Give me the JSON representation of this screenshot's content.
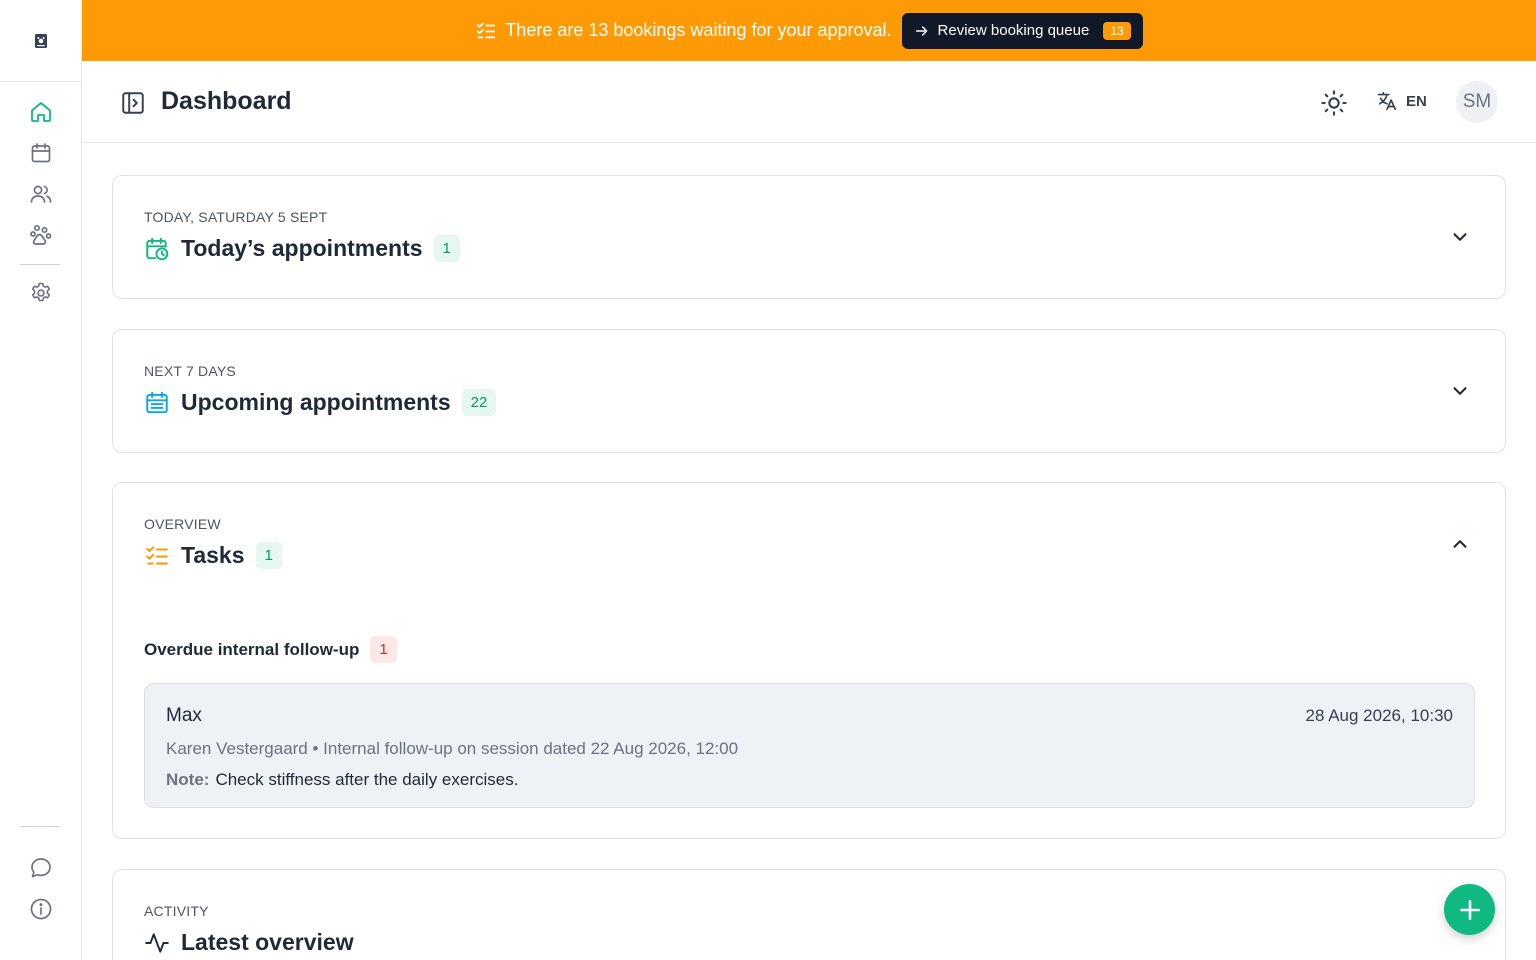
{
  "banner": {
    "message": "There are 13 bookings waiting for your approval.",
    "button_label": "Review booking queue",
    "button_count": "13"
  },
  "header": {
    "title": "Dashboard",
    "language": "EN",
    "avatar_initials": "SM"
  },
  "sidebar": {
    "items": [
      {
        "icon": "home-icon",
        "active": true
      },
      {
        "icon": "calendar-icon",
        "active": false
      },
      {
        "icon": "users-icon",
        "active": false
      },
      {
        "icon": "paw-icon",
        "active": false
      },
      {
        "icon": "settings-icon",
        "active": false
      },
      {
        "icon": "chat-icon",
        "active": false
      },
      {
        "icon": "info-icon",
        "active": false
      }
    ]
  },
  "sections": {
    "today": {
      "eyebrow": "TODAY, SATURDAY 5 SEPT",
      "title": "Today’s appointments",
      "count": "1",
      "expanded": false
    },
    "upcoming": {
      "eyebrow": "NEXT 7 DAYS",
      "title": "Upcoming appointments",
      "count": "22",
      "expanded": false
    },
    "tasks": {
      "eyebrow": "OVERVIEW",
      "title": "Tasks",
      "count": "1",
      "expanded": true,
      "group_title": "Overdue internal follow-up",
      "group_count": "1",
      "items": [
        {
          "name": "Max",
          "datetime": "28 Aug 2026, 10:30",
          "meta": "Karen Vestergaard • Internal follow-up on session dated 22 Aug 2026, 12:00",
          "note_label": "Note:",
          "note_text": "Check stiffness after the daily exercises."
        }
      ]
    },
    "activity": {
      "eyebrow": "ACTIVITY",
      "title": "Latest overview"
    }
  },
  "colors": {
    "banner": "#fd9a05",
    "accent": "#10b981",
    "active_nav": "#10b981",
    "danger": "#dc2626"
  }
}
